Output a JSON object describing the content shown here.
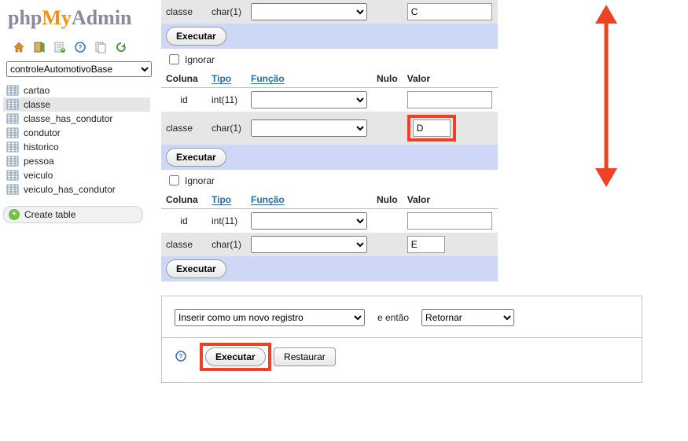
{
  "logo": {
    "php": "php",
    "my": "My",
    "admin": "Admin"
  },
  "db_selected": "controleAutomotivoBase",
  "tables": [
    {
      "name": "cartao"
    },
    {
      "name": "classe",
      "selected": true
    },
    {
      "name": "classe_has_condutor"
    },
    {
      "name": "condutor"
    },
    {
      "name": "historico"
    },
    {
      "name": "pessoa"
    },
    {
      "name": "veiculo"
    },
    {
      "name": "veiculo_has_condutor"
    }
  ],
  "create_table_label": "Create table",
  "headers": {
    "coluna": "Coluna",
    "tipo": "Tipo",
    "funcao": "Função",
    "nulo": "Nulo",
    "valor": "Valor"
  },
  "ignore_label": "Ignorar",
  "execute_label": "Executar",
  "rows0": {
    "classe_label": "classe",
    "classe_type": "char(1)",
    "classe_value": "C"
  },
  "rows1": {
    "id_label": "id",
    "id_type": "int(11)",
    "id_value": "",
    "classe_label": "classe",
    "classe_type": "char(1)",
    "classe_value": "D"
  },
  "rows2": {
    "id_label": "id",
    "id_type": "int(11)",
    "id_value": "",
    "classe_label": "classe",
    "classe_type": "char(1)",
    "classe_value": "E"
  },
  "footer": {
    "insert_where": "Inserir como um novo registro",
    "e_entao": "e então",
    "then": "Retornar",
    "executar": "Executar",
    "restaurar": "Restaurar"
  }
}
